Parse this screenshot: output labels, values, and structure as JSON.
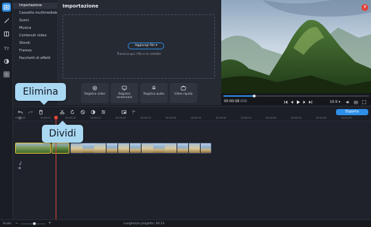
{
  "sidebar": {
    "categories": [
      {
        "label": "Importazione",
        "active": true
      },
      {
        "label": "Cassetto multimediale"
      },
      {
        "label": "Suoni"
      },
      {
        "label": "Musica"
      },
      {
        "label": "Contenuti video"
      },
      {
        "label": "Sfondi"
      },
      {
        "label": "Frames"
      },
      {
        "label": "Pacchetti di effetti"
      }
    ]
  },
  "import_panel": {
    "title": "Importazione",
    "add_files_label": "Aggiungi file",
    "drop_hint": "Trascina qui i file e le cartelle",
    "tools": [
      {
        "icon": "record-video-icon",
        "label": "Registra video"
      },
      {
        "icon": "screencast-icon",
        "label": "Registra screencast"
      },
      {
        "icon": "microphone-icon",
        "label": "Registra audio"
      },
      {
        "icon": "video-quick-icon",
        "label": "Video rapido"
      }
    ]
  },
  "player": {
    "current_time": "00:00:08",
    "current_time_fraction": ".000",
    "aspect_ratio": "16:9",
    "progress": 0.21
  },
  "toolbar": {
    "export_label": "Esporta"
  },
  "timeline": {
    "ruler_labels": [
      "00:00:00",
      "00:00:05",
      "00:00:10",
      "00:00:15",
      "00:00:20",
      "00:00:25",
      "00:00:30",
      "00:00:35",
      "00:00:40",
      "00:00:45",
      "00:00:50",
      "00:00:55",
      "00:01:00",
      "00:01:05"
    ]
  },
  "status": {
    "scale_label": "Scala:",
    "project_length_label": "Lunghezza progetto:",
    "project_length_value": "00:33",
    "zoom": 0.55
  },
  "notification_count": "7",
  "callouts": {
    "delete": "Elimina",
    "split": "Dividi"
  },
  "colors": {
    "accent": "#2e8fe8",
    "playhead": "#e0413b",
    "selection": "#e1c63a",
    "callout_bg": "#a9d8f3"
  }
}
